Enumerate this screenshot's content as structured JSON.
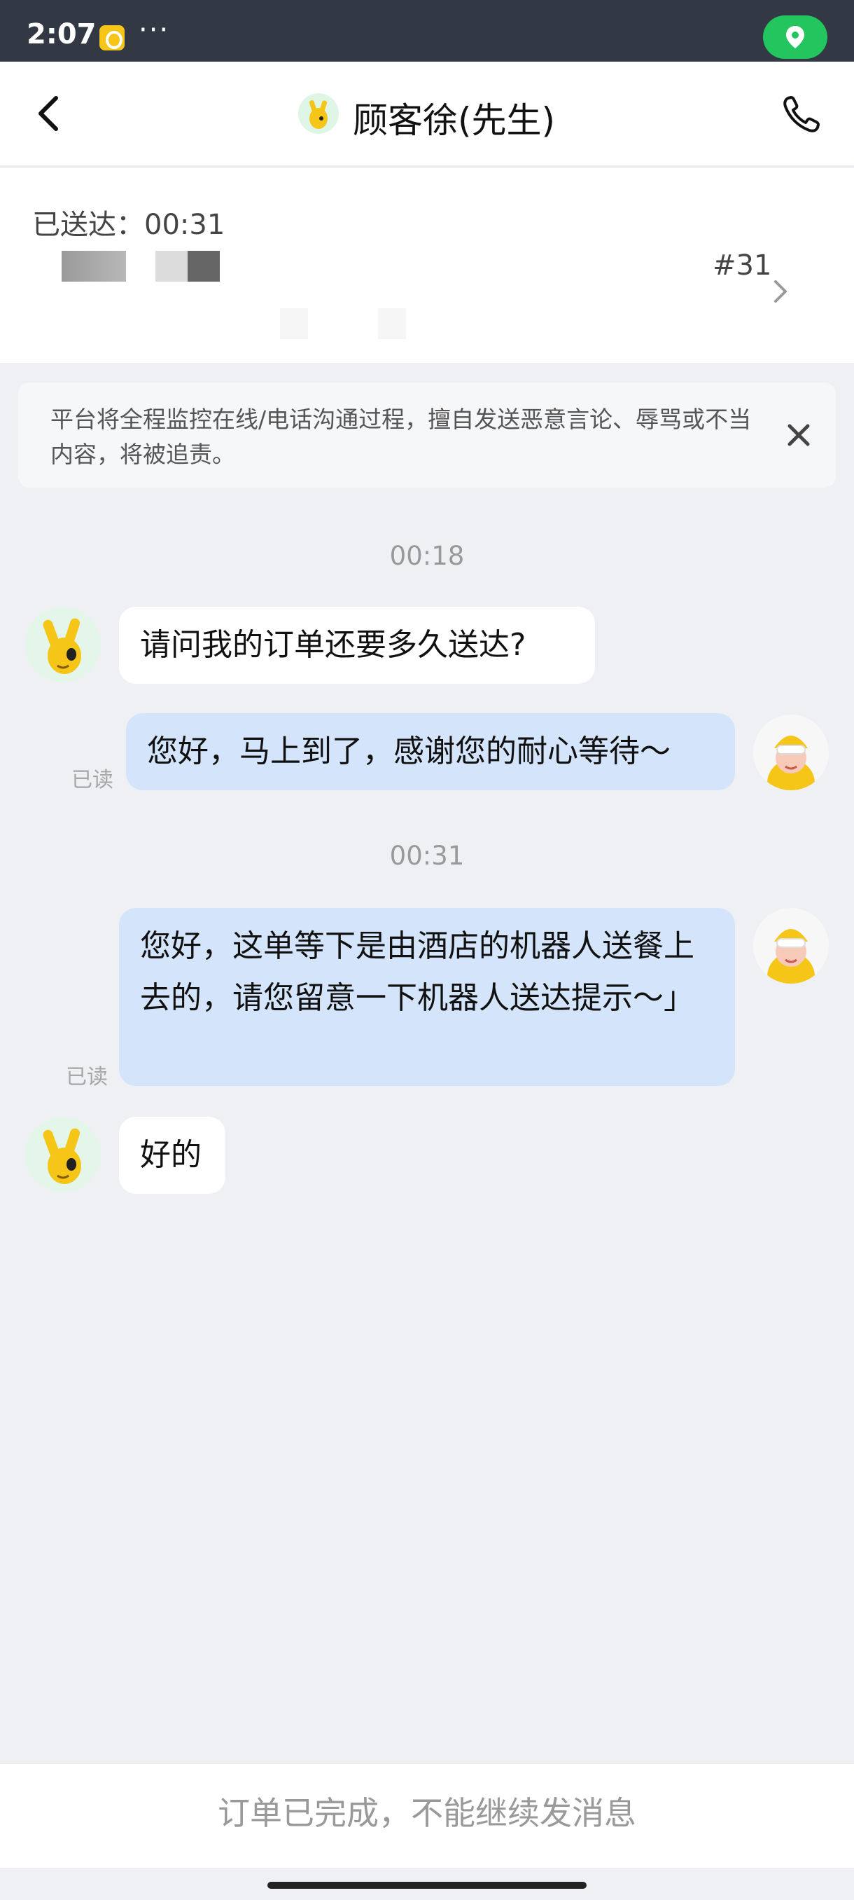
{
  "status_bar": {
    "time": "2:07",
    "dots": "···"
  },
  "header": {
    "title": "顾客徐(先生)"
  },
  "order": {
    "status": "已送达：00:31",
    "number": "#31"
  },
  "notice": {
    "text": "平台将全程监控在线/电话沟通过程，擅自发送恶意言论、辱骂或不当内容，将被追责。"
  },
  "chat": {
    "timestamps": [
      "00:18",
      "00:31"
    ],
    "messages": [
      {
        "from": "customer",
        "text": "请问我的订单还要多久送达?"
      },
      {
        "from": "rider",
        "text": "您好，马上到了，感谢您的耐心等待～",
        "read": "已读"
      },
      {
        "from": "rider",
        "text": "您好，这单等下是由酒店的机器人送餐上去的，请您留意一下机器人送达提示～」",
        "read": "已读"
      },
      {
        "from": "customer",
        "text": "好的"
      }
    ]
  },
  "footer": {
    "text": "订单已完成，不能继续发消息"
  },
  "icons": [
    "back-icon",
    "phone-icon",
    "close-icon",
    "chevron-right-icon",
    "location-icon"
  ],
  "colors": {
    "status_bar": "#323844",
    "bubble_out": "#d4e5fb",
    "location_pill": "#22c55e"
  }
}
